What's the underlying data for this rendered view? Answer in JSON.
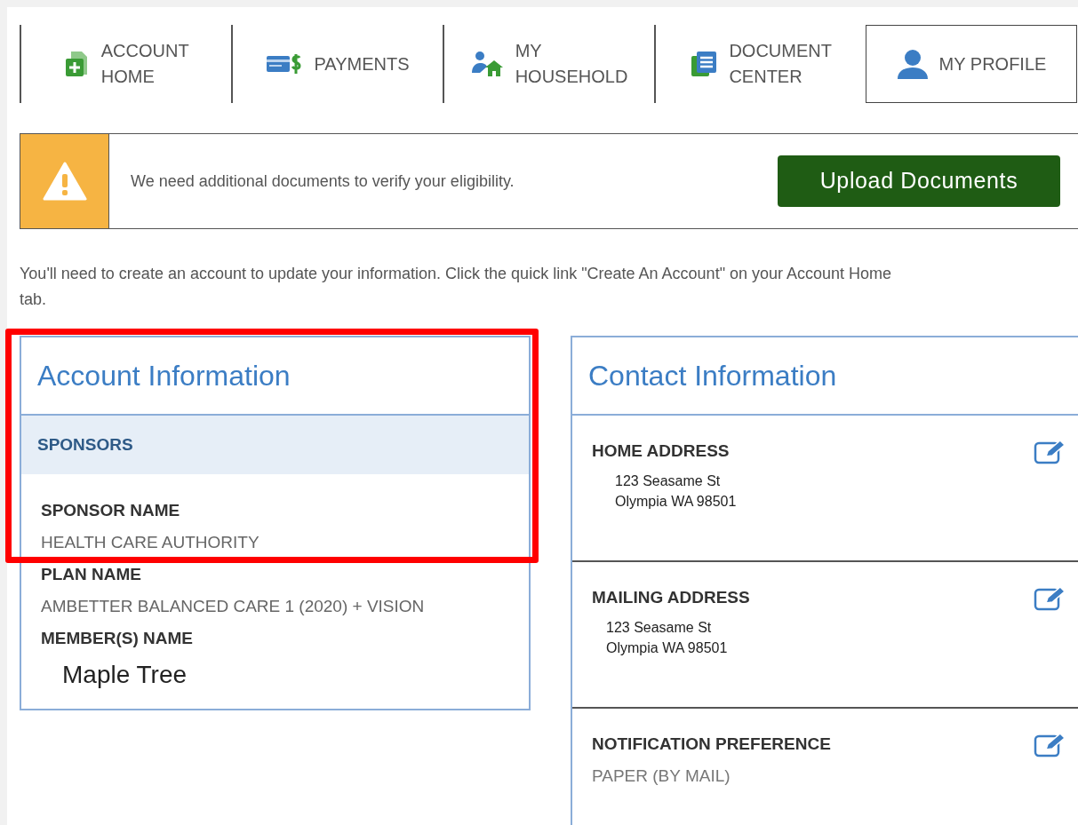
{
  "tabs": [
    {
      "label": "ACCOUNT HOME",
      "kind": "stacked",
      "selected": false
    },
    {
      "label": "PAYMENTS",
      "kind": "inline",
      "selected": false
    },
    {
      "label": "MY HOUSEHOLD",
      "kind": "stacked",
      "selected": false
    },
    {
      "label": "DOCUMENT CENTER",
      "kind": "stacked",
      "selected": false
    },
    {
      "label": "MY PROFILE",
      "kind": "inline",
      "selected": true
    }
  ],
  "alert": {
    "message": "We need additional documents to verify your eligibility.",
    "button": "Upload Documents"
  },
  "notice": "You'll need to create an account to update your information. Click the quick link \"Create An Account\" on your Account Home tab.",
  "account_information": {
    "title": "Account Information",
    "section": "SPONSORS",
    "highlighted": true,
    "fields": [
      {
        "label": "SPONSOR NAME",
        "value": "HEALTH CARE AUTHORITY",
        "kind": "plain"
      },
      {
        "label": "PLAN NAME",
        "value": "AMBETTER BALANCED CARE 1 (2020) + VISION",
        "kind": "plain"
      },
      {
        "label": "MEMBER(S) NAME",
        "value": "Maple Tree",
        "kind": "large"
      }
    ]
  },
  "contact_information": {
    "title": "Contact Information",
    "sections": [
      {
        "label": "HOME ADDRESS",
        "kind": "address",
        "lines": [
          "123 Seasame St",
          "Olympia WA 98501"
        ]
      },
      {
        "label": "MAILING ADDRESS",
        "kind": "address",
        "lines": [
          "123 Seasame St",
          "Olympia WA 98501"
        ]
      },
      {
        "label": "NOTIFICATION PREFERENCE",
        "kind": "plain",
        "lines": [
          "PAPER (BY MAIL)"
        ]
      }
    ]
  }
}
